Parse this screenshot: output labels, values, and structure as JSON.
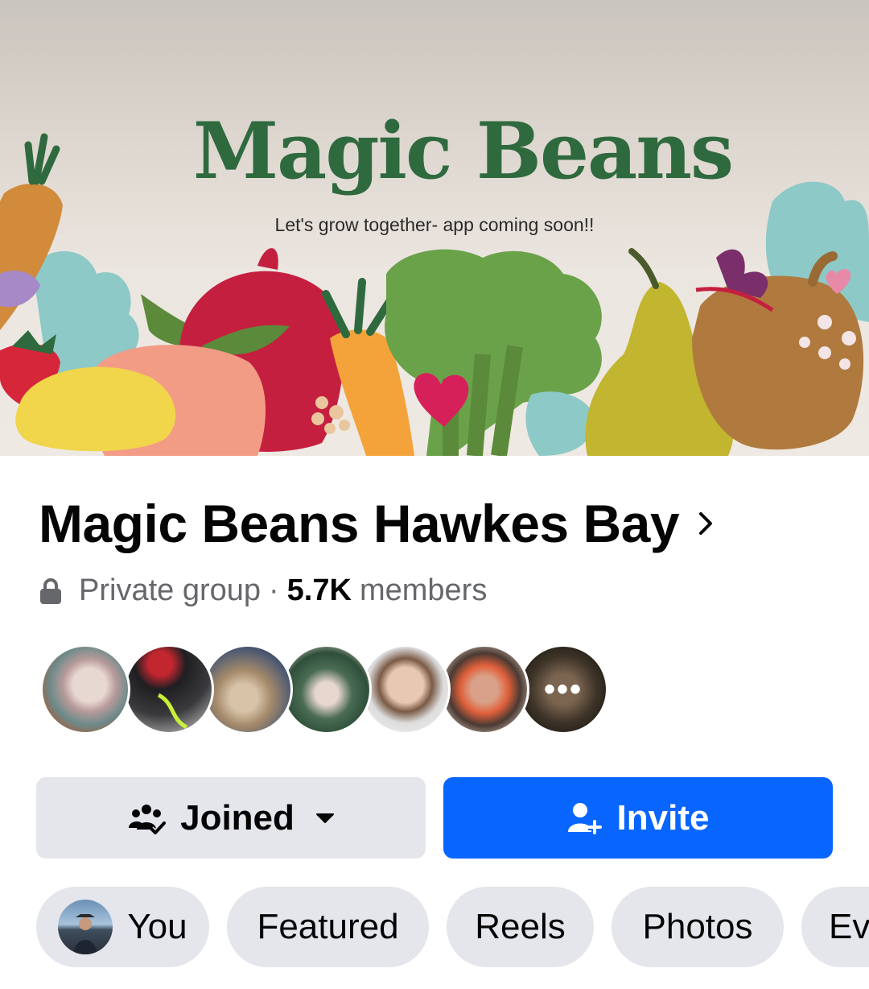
{
  "cover": {
    "title": "Magic Beans",
    "tagline": "Let's grow together- app coming soon!!"
  },
  "group": {
    "name": "Magic Beans Hawkes Bay",
    "privacy": "Private group",
    "separator": "·",
    "member_count": "5.7K",
    "member_label": "members"
  },
  "avatars": {
    "more_label": "•••"
  },
  "actions": {
    "joined_label": "Joined",
    "invite_label": "Invite"
  },
  "tabs": [
    {
      "label": "You"
    },
    {
      "label": "Featured"
    },
    {
      "label": "Reels"
    },
    {
      "label": "Photos"
    },
    {
      "label": "Ev"
    }
  ],
  "colors": {
    "accent": "#0866ff",
    "secondary_button": "#e4e6eb",
    "title_green": "#2f6a3f"
  }
}
